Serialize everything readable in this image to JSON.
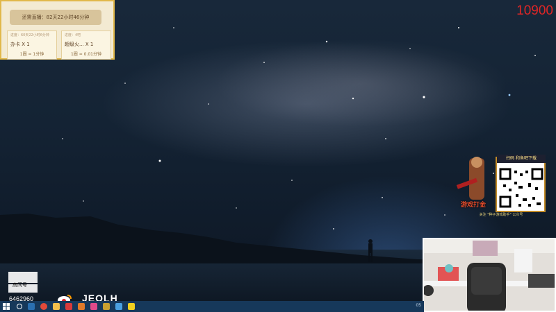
{
  "event_panel": {
    "banner_text": "还需直播：82天22小时46分钟",
    "cards": [
      {
        "caption": "进度：60天22小时6分钟",
        "name": "办卡 X 1",
        "rate": "1圈 = 1分钟"
      },
      {
        "caption": "进度：4吧",
        "name": "超级火... X 1",
        "rate": "1圈 = 0.01分钟"
      }
    ]
  },
  "room_count": "10900",
  "ad": {
    "header": "扫码 和鱼吧下载",
    "game_title": "游戏打金",
    "caption": "关注 \"种子游戏助手\" 公众号"
  },
  "branding": {
    "room_label": "房间号",
    "room_number": "6462960",
    "weibo_name": "JEOLH"
  },
  "taskbar": {
    "icons": [
      "windows-start",
      "search",
      "steam",
      "chrome",
      "folder",
      "app-red",
      "app-orange",
      "app-gold",
      "app-blue",
      "app-yellow"
    ],
    "tray_text": "05"
  }
}
